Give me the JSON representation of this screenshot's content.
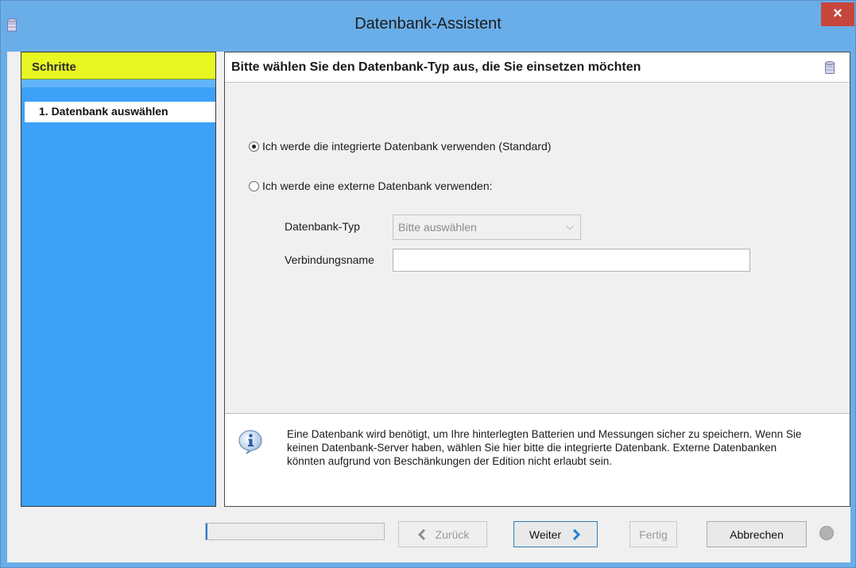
{
  "window": {
    "title": "Datenbank-Assistent",
    "close_label": "×",
    "app_icon": "database-icon"
  },
  "steps": {
    "header": "Schritte",
    "items": [
      {
        "label": "1. Datenbank auswählen",
        "active": true
      }
    ]
  },
  "main": {
    "title": "Bitte wählen Sie den Datenbank-Typ aus, die Sie einsetzen möchten",
    "header_icon": "database-icon",
    "options": [
      {
        "label": "Ich werde die integrierte Datenbank verwenden (Standard)",
        "checked": true
      },
      {
        "label": "Ich werde eine externe Datenbank verwenden:",
        "checked": false
      }
    ],
    "db_type_label": "Datenbank-Typ",
    "db_type_value": "Bitte auswählen",
    "connection_label": "Verbindungsname",
    "connection_value": ""
  },
  "info": {
    "icon": "info-icon",
    "text": "Eine Datenbank wird benötigt, um Ihre hinterlegten Batterien und Messungen sicher zu speichern. Wenn Sie keinen Datenbank-Server haben, wählen Sie hier bitte die integrierte Datenbank. Externe Datenbanken könnten aufgrund von Beschänkungen der Edition nicht erlaubt sein."
  },
  "footer": {
    "progress_fraction": 0.01,
    "back_label": "Zurück",
    "next_label": "Weiter",
    "finish_label": "Fertig",
    "cancel_label": "Abbrechen",
    "help_icon": "help-icon"
  },
  "colors": {
    "title_bar": "#6aaee9",
    "steps_header": "#e8f623",
    "steps_panel": "#3da1f7",
    "close_button": "#c7463c",
    "next_arrow": "#1e7fd8"
  }
}
